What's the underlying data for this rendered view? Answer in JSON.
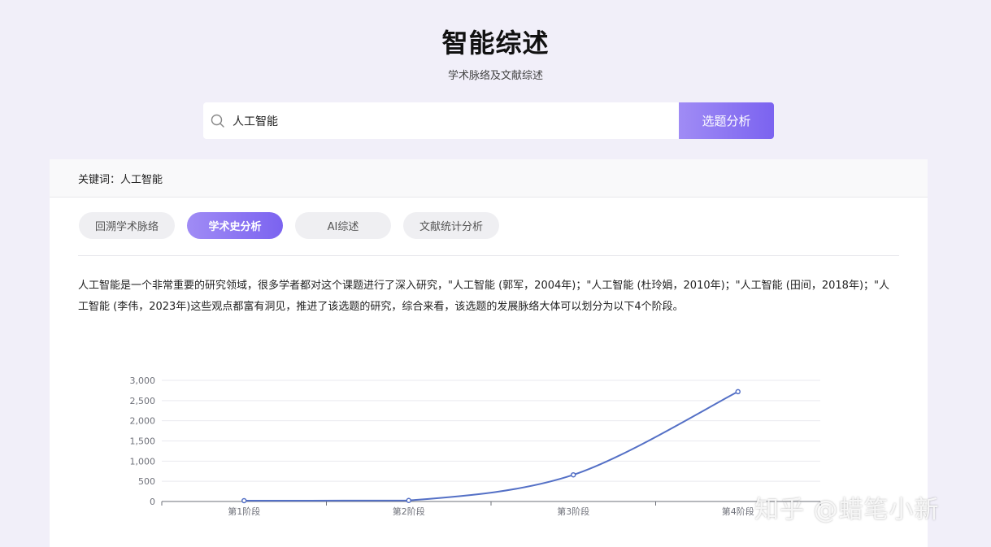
{
  "header": {
    "title": "智能综述",
    "subtitle": "学术脉络及文献综述"
  },
  "search": {
    "value": "人工智能",
    "button_label": "选题分析"
  },
  "keyword_bar": {
    "text": "关键词：人工智能"
  },
  "tabs": [
    {
      "label": "回溯学术脉络",
      "active": false
    },
    {
      "label": "学术史分析",
      "active": true
    },
    {
      "label": "AI综述",
      "active": false
    },
    {
      "label": "文献统计分析",
      "active": false
    }
  ],
  "description": "人工智能是一个非常重要的研究领域，很多学者都对这个课题进行了深入研究，\"人工智能 (郭军，2004年)；\"人工智能 (杜玲娟，2010年)；\"人工智能 (田间，2018年)；\"人工智能 (李伟，2023年)这些观点都富有洞见，推进了该选题的研究，综合来看，该选题的发展脉络大体可以划分为以下4个阶段。",
  "chart_data": {
    "type": "line",
    "categories": [
      "第1阶段",
      "第2阶段",
      "第3阶段",
      "第4阶段"
    ],
    "series": [
      {
        "values": [
          20,
          25,
          660,
          2720
        ],
        "color": "#5470c6"
      }
    ],
    "ylim": [
      0,
      3000
    ],
    "yticks": [
      "0",
      "500",
      "1,000",
      "1,500",
      "2,000",
      "2,500",
      "3,000"
    ],
    "grid": true
  },
  "watermark": "知乎 @蜡笔小新",
  "colors": {
    "accent": "#7b63f0",
    "line": "#5470c6"
  }
}
